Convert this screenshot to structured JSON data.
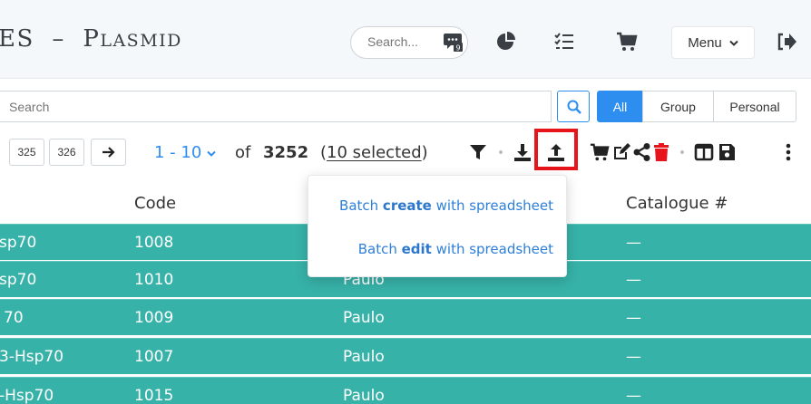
{
  "header": {
    "title_part1": "ES  –  P",
    "title_part2": "LASMID",
    "search_placeholder": "Search...",
    "badge_count": "9",
    "menu_label": "Menu"
  },
  "search": {
    "placeholder": "Search",
    "scopes": [
      "All",
      "Group",
      "Personal"
    ],
    "active_scope": "All"
  },
  "pagination": {
    "pages": [
      "325",
      "326"
    ],
    "range": "1 - 10",
    "of_label": "of",
    "total": "3252",
    "selected_label": "10 selected"
  },
  "batch_menu": {
    "create_prefix": "Batch ",
    "create_bold": "create",
    "create_suffix": " with spreadsheet",
    "edit_prefix": "Batch ",
    "edit_bold": "edit",
    "edit_suffix": " with spreadsheet"
  },
  "table": {
    "headers": [
      "Code",
      "Catalogue #"
    ],
    "rows": [
      {
        "name": "sp70",
        "code": "1008",
        "owner": "",
        "catalogue": "—"
      },
      {
        "name": "sp70",
        "code": "1010",
        "owner": "Paulo",
        "catalogue": "—"
      },
      {
        "name": "70",
        "code": "1009",
        "owner": "Paulo",
        "catalogue": "—"
      },
      {
        "name": "3-Hsp70",
        "code": "1007",
        "owner": "Paulo",
        "catalogue": "—"
      },
      {
        "name": "-Hsp70",
        "code": "1015",
        "owner": "Paulo",
        "catalogue": "—"
      }
    ]
  },
  "colors": {
    "accent": "#2e8ef0",
    "row_bg": "#37b2a8",
    "highlight": "#e8141b",
    "delete": "#e8141b"
  },
  "icons": [
    "chat-badge-icon",
    "pie-chart-icon",
    "checklist-icon",
    "cart-icon",
    "chevron-down-icon",
    "logout-icon",
    "search-icon",
    "arrow-right-icon",
    "chevron-down-icon",
    "filter-icon",
    "download-icon",
    "upload-icon",
    "cart-icon",
    "edit-icon",
    "share-icon",
    "trash-icon",
    "columns-icon",
    "save-icon",
    "more-vertical-icon"
  ]
}
